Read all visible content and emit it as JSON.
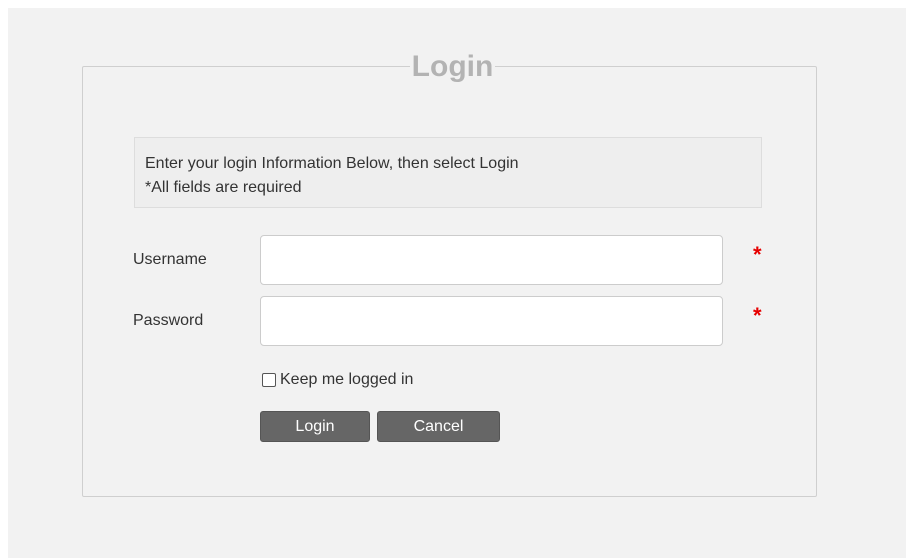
{
  "login_panel": {
    "title": "Login",
    "info": {
      "line1": "Enter your login Information Below, then select Login",
      "line2": "*All fields are required"
    },
    "username": {
      "label": "Username",
      "value": "",
      "required_mark": "*"
    },
    "password": {
      "label": "Password",
      "value": "",
      "required_mark": "*"
    },
    "remember": {
      "label": "Keep me logged in",
      "checked": false
    },
    "buttons": {
      "login_label": "Login",
      "cancel_label": "Cancel"
    }
  },
  "colors": {
    "title": "#b3b3b3",
    "required_star": "#e60000",
    "button_bg": "#666666",
    "panel_bg": "#f2f2f2"
  }
}
